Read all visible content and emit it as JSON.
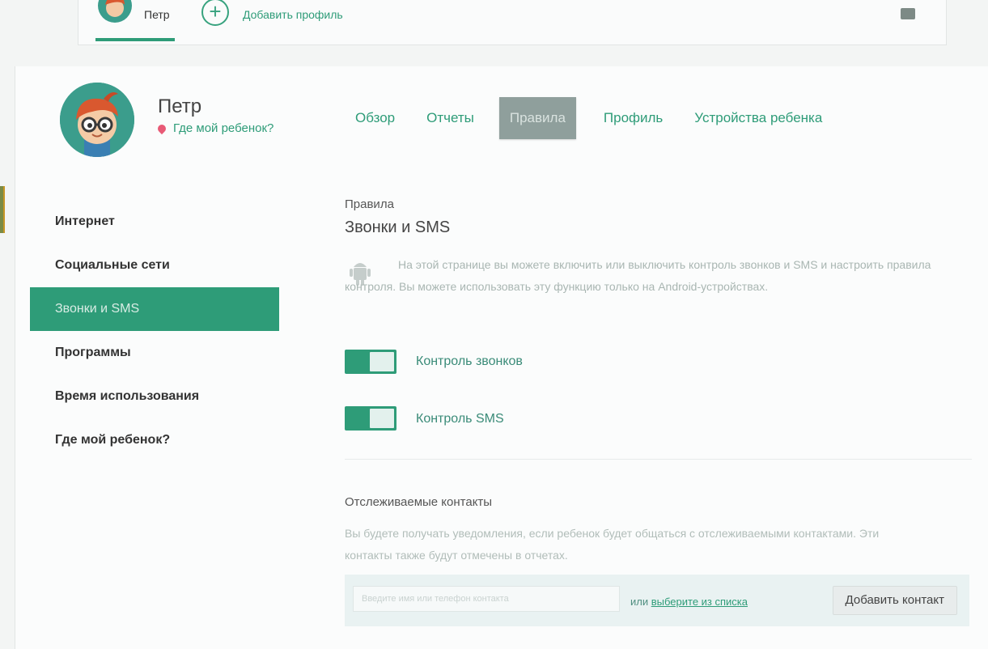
{
  "top_profiles": {
    "current_name": "Петр",
    "add_profile_label": "Добавить профиль"
  },
  "child": {
    "name": "Петр",
    "where_link": "Где мой ребенок?"
  },
  "tabs": [
    {
      "label": "Обзор"
    },
    {
      "label": "Отчеты"
    },
    {
      "label": "Правила",
      "active": true
    },
    {
      "label": "Профиль"
    },
    {
      "label": "Устройства ребенка"
    }
  ],
  "sidebar": {
    "items": [
      {
        "label": "Интернет"
      },
      {
        "label": "Социальные сети"
      },
      {
        "label": "Звонки и SMS",
        "active": true
      },
      {
        "label": "Программы"
      },
      {
        "label": "Время использования"
      },
      {
        "label": "Где мой ребенок?"
      }
    ]
  },
  "content": {
    "breadcrumb": "Правила",
    "title": "Звонки и SMS",
    "description": "На этой странице вы можете включить или выключить контроль звонков и SMS и настроить правила контроля. Вы можете использовать эту функцию только на Android-устройствах.",
    "toggles": [
      {
        "label": "Контроль звонков",
        "on": true
      },
      {
        "label": "Контроль SMS",
        "on": true
      }
    ],
    "tracked": {
      "title": "Отслеживаемые контакты",
      "description": "Вы будете получать уведомления, если ребенок будет общаться с отслеживаемыми контактами. Эти контакты также будут отмечены в отчетах.",
      "input_placeholder": "Введите имя или телефон контакта",
      "or_text": "или",
      "choose_link": "выберите из списка",
      "add_button": "Добавить контакт"
    }
  },
  "colors": {
    "accent": "#2e9c78",
    "active_tab": "#8f9f9c",
    "pin": "#e85a76"
  }
}
